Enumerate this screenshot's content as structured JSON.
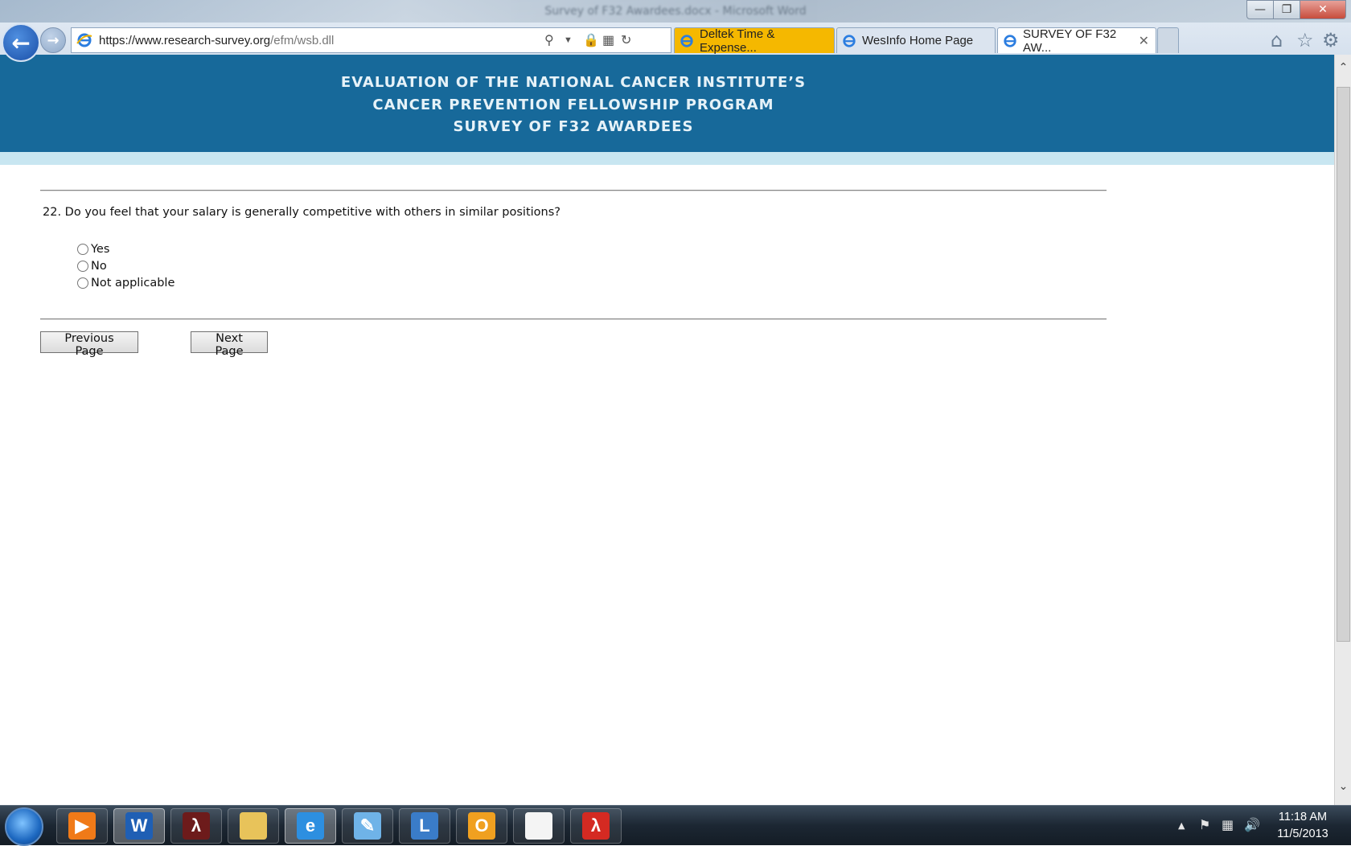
{
  "window": {
    "title": "Survey of F32 Awardees.docx - Microsoft Word"
  },
  "browser": {
    "address": {
      "url_main": "https://www.research-survey.org",
      "url_rest": "/efm/wsb.dll"
    },
    "tabs": [
      {
        "label": "Deltek Time & Expense..."
      },
      {
        "label": "WesInfo Home Page"
      },
      {
        "label": "SURVEY OF F32 AW..."
      }
    ]
  },
  "banner": {
    "line1": "EVALUATION OF THE NATIONAL CANCER INSTITUTE’S",
    "line2": "CANCER PREVENTION FELLOWSHIP PROGRAM",
    "line3": "SURVEY OF F32 AWARDEES"
  },
  "survey": {
    "question": "22. Do you feel that your salary is generally competitive with others in similar positions?",
    "options": [
      "Yes",
      "No",
      "Not applicable"
    ],
    "prev_label": "Previous Page",
    "next_label": "Next Page"
  },
  "taskbar": {
    "apps": [
      "media-player",
      "word",
      "acrobat",
      "explorer",
      "internet-explorer",
      "notepad-blue",
      "lync",
      "outlook",
      "blank-document",
      "acrobat-pdf"
    ],
    "time": "11:18 AM",
    "date": "11/5/2013"
  },
  "colors": {
    "banner": "#17699a",
    "banner_band": "#c8e6f1",
    "deltek_tab": "#f5b800"
  }
}
